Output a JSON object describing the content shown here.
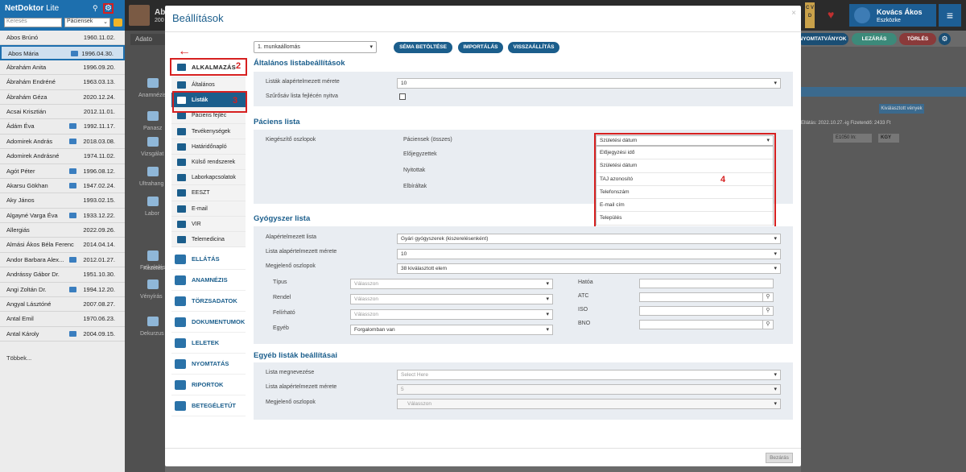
{
  "left_panel": {
    "app_title": "NetDoktor",
    "app_subtitle": "Lite",
    "search_placeholder": "Keresés",
    "filter_value": "Páciensek",
    "more_label": "Többek...",
    "patients": [
      {
        "name": "Abos Brúnó",
        "date": "1960.11.02.",
        "file": false
      },
      {
        "name": "Abos Mária",
        "date": "1996.04.30.",
        "file": true
      },
      {
        "name": "Ábrahám Anita",
        "date": "1996.09.20.",
        "file": false
      },
      {
        "name": "Ábrahám Endréné",
        "date": "1963.03.13.",
        "file": false
      },
      {
        "name": "Ábrahám Géza",
        "date": "2020.12.24.",
        "file": false
      },
      {
        "name": "Acsai Krisztián",
        "date": "2012.11.01.",
        "file": false
      },
      {
        "name": "Ádám Éva",
        "date": "1992.11.17.",
        "file": true
      },
      {
        "name": "Adomirek András",
        "date": "2018.03.08.",
        "file": true
      },
      {
        "name": "Adomirek Andrásné",
        "date": "1974.11.02.",
        "file": false
      },
      {
        "name": "Agót Péter",
        "date": "1996.08.12.",
        "file": true
      },
      {
        "name": "Akarsu Gökhan",
        "date": "1947.02.24.",
        "file": true
      },
      {
        "name": "Aky János",
        "date": "1993.02.15.",
        "file": false
      },
      {
        "name": "Algayné Varga Éva",
        "date": "1933.12.22.",
        "file": true
      },
      {
        "name": "Allergiás",
        "date": "2022.09.26.",
        "file": false
      },
      {
        "name": "Almási Ákos Béla Ferenc",
        "date": "2014.04.14.",
        "file": false
      },
      {
        "name": "Andor Barbara Alex...",
        "date": "2012.01.27.",
        "file": true
      },
      {
        "name": "Andrássy Gábor Dr.",
        "date": "1951.10.30.",
        "file": false
      },
      {
        "name": "Angi Zoltán Dr.",
        "date": "1994.12.20.",
        "file": true
      },
      {
        "name": "Angyal Lásztóné",
        "date": "2007.08.27.",
        "file": false
      },
      {
        "name": "Antal Emil",
        "date": "1970.06.23.",
        "file": false
      },
      {
        "name": "Antal Károly",
        "date": "2004.09.15.",
        "file": true
      }
    ]
  },
  "background": {
    "user_name": "Kovács Ákos",
    "user_role": "Eszközke",
    "partial_title": "Ab",
    "partial_year": "200",
    "nav_title": "Adato",
    "nav_labels": [
      "Anamnézis",
      "Panasz",
      "Vizsgálat",
      "Ultrahang",
      "Labor",
      "Felkelelés",
      "Kezelés",
      "Vényírás",
      "Dekurzus"
    ],
    "buttons": [
      "NYOMTATVÁNYOK",
      "LEZÁRÁS",
      "TÖRLÉS"
    ],
    "cvd": "C V D",
    "misc_texts": [
      "Kiválasztott vények",
      "Ellátás: 2022.10.27.-ig  Fizetendő: 2433 Ft",
      "E1050 In:",
      "KGY"
    ]
  },
  "modal": {
    "title": "Beállítások",
    "close_label": "Bezárás",
    "nav": {
      "app_label": "ALKALMAZÁS",
      "items": [
        "Általános",
        "Listák",
        "Páciens fejléc",
        "Tevékenységek",
        "Határidőnapló",
        "Külső rendszerek",
        "Laborkapcsolatok",
        "EESZT",
        "E-mail",
        "VIR",
        "Telemedicina"
      ],
      "groups": [
        "ELLÁTÁS",
        "ANAMNÉZIS",
        "TÖRZSADATOK",
        "DOKUMENTUMOK",
        "LELETEK",
        "NYOMTATÁS",
        "RIPORTOK",
        "BETEGÉLETÚT"
      ]
    },
    "annotations": [
      "2",
      "3",
      "4"
    ],
    "workstation": "1. munkaállomás",
    "toolbar": [
      "SÉMA BETÖLTÉSE",
      "IMPORTÁLÁS",
      "VISSZAÁLLÍTÁS"
    ],
    "general": {
      "title": "Általános listabeállítások",
      "size_label": "Listák alapértelmezett mérete",
      "size_value": "10",
      "filter_label": "Szűrősáv lista fejlécén nyitva"
    },
    "patient_list": {
      "title": "Páciens lista",
      "extra_cols_label": "Kiegészítő oszlopok",
      "sub_labels": [
        "Páciensek (összes)",
        "Előjegyzettek",
        "Nyitottak",
        "Elbíráltak"
      ],
      "selected": "Születési dátum",
      "options": [
        "Előjegyzési idő",
        "Születési dátum",
        "TAJ azonosító",
        "Telefonszám",
        "E-mail cím",
        "Település"
      ]
    },
    "drug_list": {
      "title": "Gyógyszer lista",
      "default_list_label": "Alapértelmezett lista",
      "default_list_value": "Gyári gyógyszerek (kiszerelésenként)",
      "size_label": "Lista alapértelmezett mérete",
      "size_value": "10",
      "cols_label": "Megjelenő oszlopok",
      "cols_value": "38 kiválasztott elem",
      "left_fields": [
        {
          "label": "Típus",
          "value": "Válasszon"
        },
        {
          "label": "Rendel",
          "value": "Válasszon"
        },
        {
          "label": "Felírható",
          "value": "Válasszon"
        },
        {
          "label": "Egyéb",
          "value": "Forgalomban van"
        }
      ],
      "right_fields": [
        "Hatóa",
        "ATC",
        "ISO",
        "BNO"
      ]
    },
    "other_list": {
      "title": "Egyéb listák beállításai",
      "name_label": "Lista megnevezése",
      "name_value": "Select Here",
      "size_label": "Lista alapértelmezett mérete",
      "size_value": "5",
      "cols_label": "Megjelenő oszlopok",
      "cols_value": "Válasszon"
    }
  }
}
